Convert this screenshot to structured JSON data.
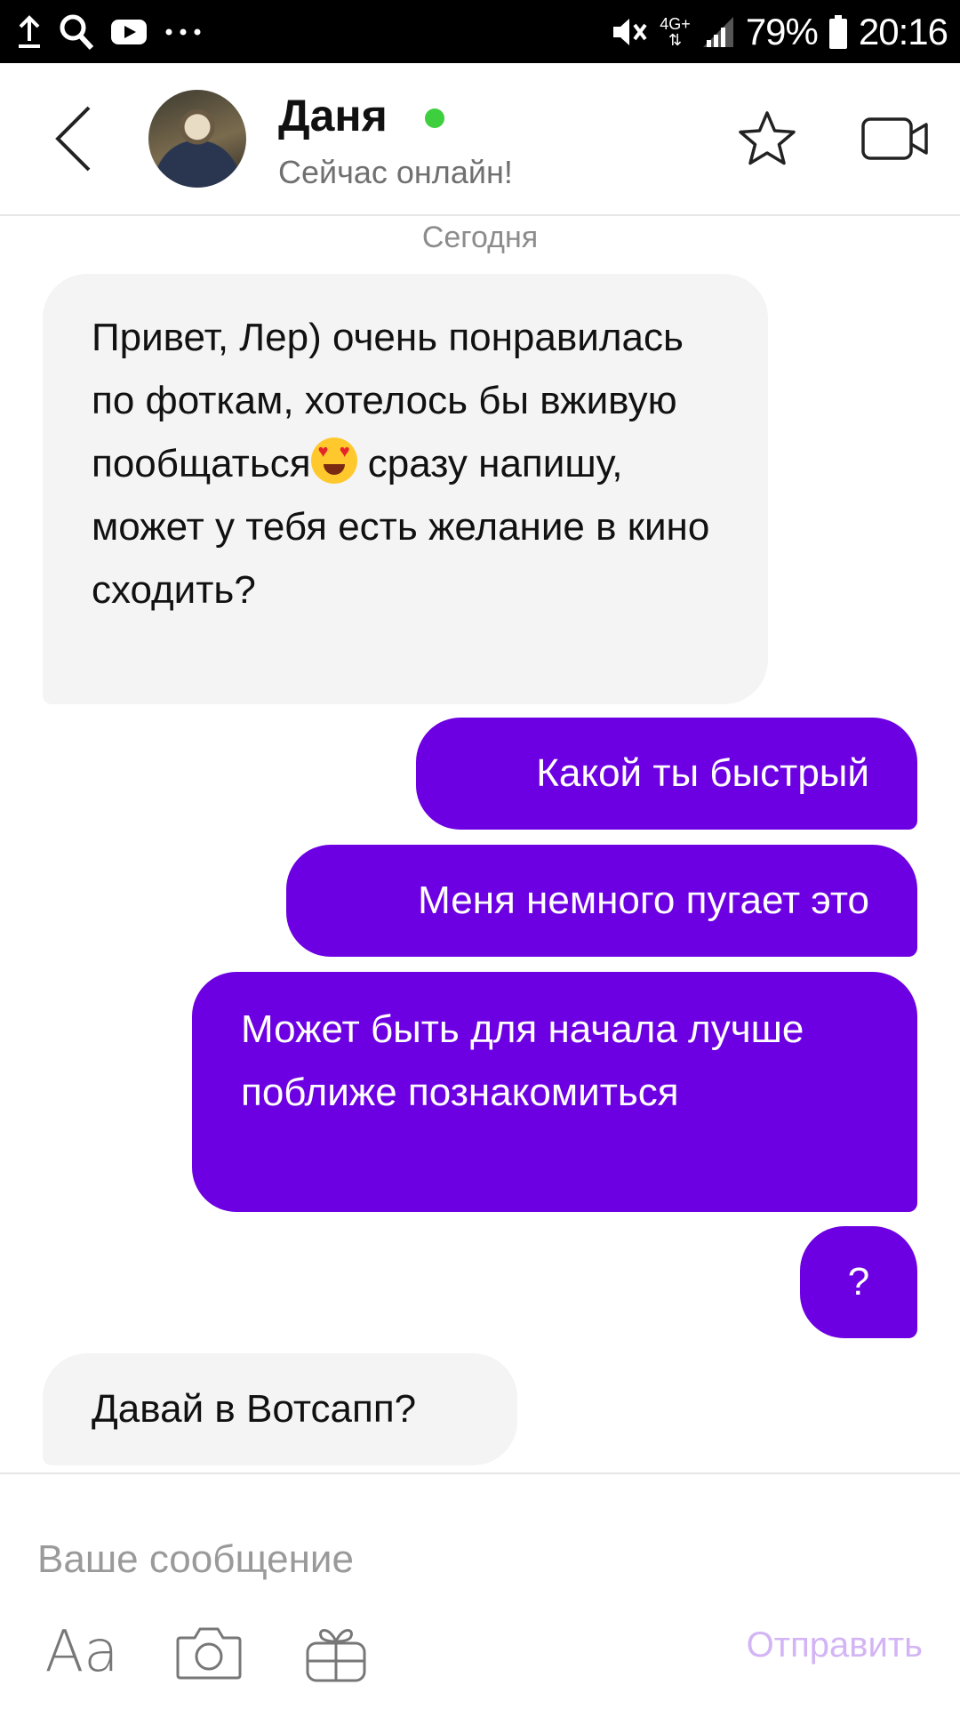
{
  "status_bar": {
    "battery": "79%",
    "time": "20:16",
    "network": "4G+"
  },
  "header": {
    "name": "Даня",
    "status": "Сейчас онлайн!"
  },
  "chat": {
    "date_label": "Сегодня",
    "messages": [
      {
        "direction": "incoming",
        "text_before_emoji": "Привет, Лер) очень понравилась по фоткам, хотелось бы вживую пообщаться",
        "text_after_emoji": " сразу напишу, может у тебя есть желание в кино сходить?"
      },
      {
        "direction": "outgoing",
        "text": "Какой ты быстрый"
      },
      {
        "direction": "outgoing",
        "text": "Меня немного пугает это"
      },
      {
        "direction": "outgoing",
        "text": "Может быть для начала лучше поближе познакомиться"
      },
      {
        "direction": "outgoing",
        "text": "?"
      },
      {
        "direction": "incoming",
        "text": "Давай в Вотсапп?"
      }
    ]
  },
  "composer": {
    "placeholder": "Ваше сообщение",
    "font_label": "Aa",
    "send_label": "Отправить"
  },
  "colors": {
    "outgoing_bubble": "#6d00e3",
    "incoming_bubble": "#f4f4f4",
    "online": "#3ecf3e",
    "send_disabled": "#d3b4f5"
  },
  "icons": [
    "upload-icon",
    "search-icon",
    "youtube-icon",
    "more-icon",
    "mute-icon",
    "signal-icon",
    "battery-icon",
    "back-arrow-icon",
    "star-icon",
    "video-call-icon",
    "emoji-heart-eyes-icon",
    "camera-icon",
    "gift-icon"
  ]
}
